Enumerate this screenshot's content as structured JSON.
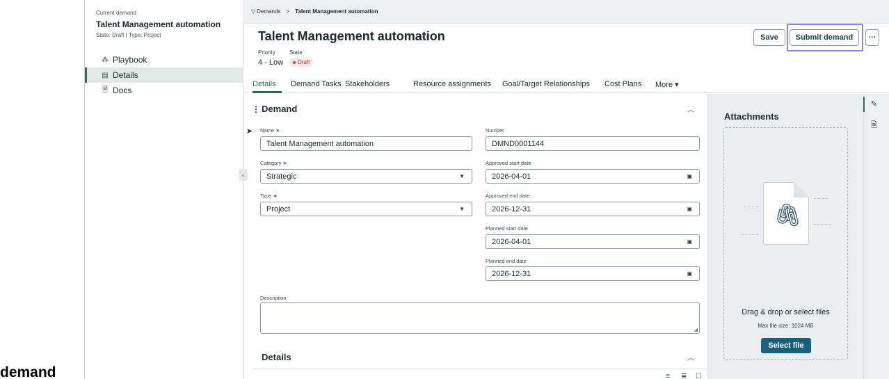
{
  "sidebar": {
    "current_label": "Current demand",
    "demand_title": "Talent Management automation",
    "state_line": "State: Draft  |  Type: Project",
    "items": [
      {
        "icon": "playbook-icon",
        "label": "Playbook"
      },
      {
        "icon": "details-icon",
        "label": "Details",
        "active": true
      },
      {
        "icon": "docs-icon",
        "label": "Docs"
      }
    ]
  },
  "overlay_word": "demand",
  "breadcrumb": {
    "root": "Demands",
    "separator": ">",
    "current": "Talent Management automation"
  },
  "header": {
    "title": "Talent Management automation",
    "priority_label": "Priority",
    "priority_value": "4 - Low",
    "state_label": "State",
    "state_value": "Draft",
    "save_label": "Save",
    "submit_label": "Submit demand",
    "more_label": "···"
  },
  "tabs": [
    {
      "label": "Details",
      "active": true
    },
    {
      "label": "Demand Tasks"
    },
    {
      "label": "Stakeholders"
    },
    {
      "label": "Resource assignments"
    },
    {
      "label": "Goal/Target Relationships"
    },
    {
      "label": "Cost Plans"
    },
    {
      "label": "More ▾"
    }
  ],
  "demand_section": {
    "title": "Demand",
    "name_label": "Name ∗",
    "name_value": "Talent Management automation",
    "number_label": "Number",
    "number_value": "DMND0001144",
    "category_label": "Category ∗",
    "category_value": "Strategic",
    "approved_start_label": "Approved start date",
    "approved_start_value": "2026-04-01",
    "type_label": "Type ∗",
    "type_value": "Project",
    "approved_end_label": "Approved end date",
    "approved_end_value": "2026-12-31",
    "planned_start_label": "Planned start date",
    "planned_start_value": "2026-04-01",
    "planned_end_label": "Planned end date",
    "planned_end_value": "2026-12-31",
    "description_label": "Description",
    "description_value": ""
  },
  "details_section": {
    "title": "Details"
  },
  "attachments": {
    "title": "Attachments",
    "drop_text": "Drag & drop or select files",
    "max_size": "Max file size: 1024 MB",
    "select_label": "Select file"
  },
  "colors": {
    "accent_green": "#2d6e4e",
    "primary_button": "#15627e",
    "focus_ring": "#8b84e8",
    "draft_red": "#b8343f"
  }
}
